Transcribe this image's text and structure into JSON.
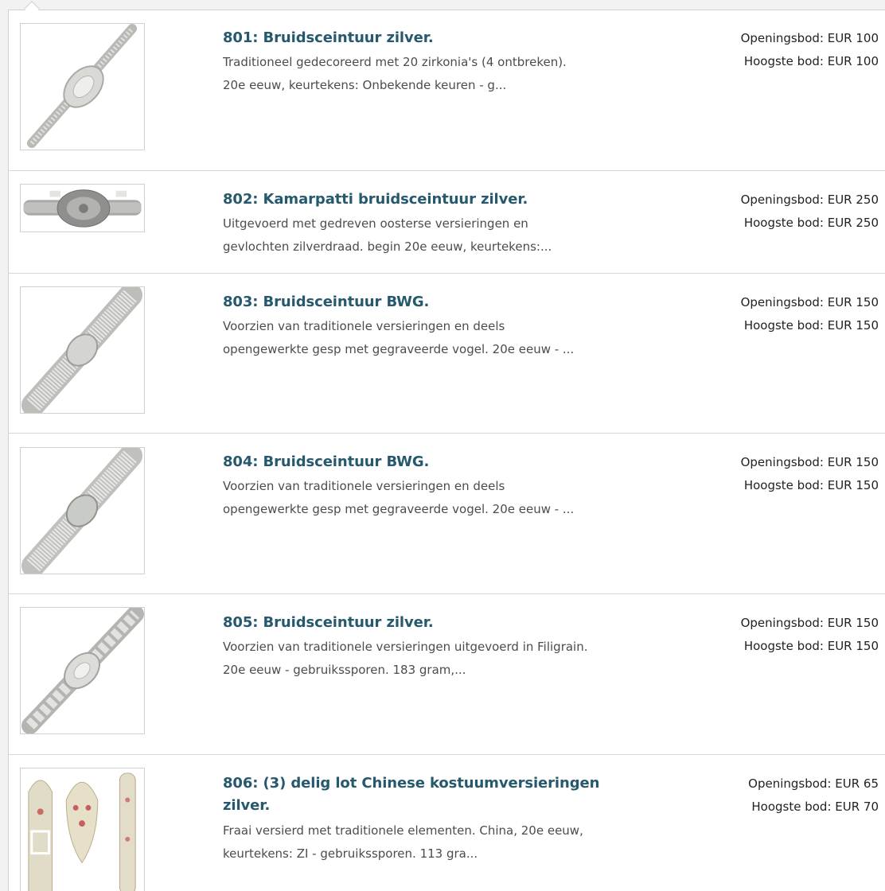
{
  "lots": [
    {
      "title": "801: Bruidsceintuur zilver.",
      "desc_lines": [
        "Traditioneel gedecoreerd met 20 zirkonia's (4 ontbreken).",
        "20e eeuw, keurtekens: Onbekende keuren - g..."
      ],
      "opening_bid": "Openingsbod: EUR 100",
      "highest_bid": "Hoogste bod: EUR 100",
      "image": "diagonal-belt-thumbnail"
    },
    {
      "title": "802: Kamarpatti bruidsceintuur zilver.",
      "desc_lines": [
        "Uitgevoerd met gedreven oosterse versieringen en",
        "gevlochten zilverdraad. begin 20e eeuw, keurtekens:..."
      ],
      "opening_bid": "Openingsbod: EUR 250",
      "highest_bid": "Hoogste bod: EUR 250",
      "image": "horizontal-belt-thumbnail"
    },
    {
      "title": "803: Bruidsceintuur BWG.",
      "desc_lines": [
        "Voorzien van traditionele versieringen en deels",
        "opengewerkte gesp met gegraveerde vogel. 20e eeuw - ..."
      ],
      "opening_bid": "Openingsbod: EUR 150",
      "highest_bid": "Hoogste bod: EUR 150",
      "image": "diagonal-mesh-belt-thumbnail"
    },
    {
      "title": "804: Bruidsceintuur BWG.",
      "desc_lines": [
        "Voorzien van traditionele versieringen en deels",
        "opengewerkte gesp met gegraveerde vogel. 20e eeuw - ..."
      ],
      "opening_bid": "Openingsbod: EUR 150",
      "highest_bid": "Hoogste bod: EUR 150",
      "image": "diagonal-mesh-belt-thumbnail"
    },
    {
      "title": "805: Bruidsceintuur zilver.",
      "desc_lines": [
        "Voorzien van traditionele versieringen uitgevoerd in Filigrain.",
        "20e eeuw - gebruikssporen. 183 gram,..."
      ],
      "opening_bid": "Openingsbod: EUR 150",
      "highest_bid": "Hoogste bod: EUR 150",
      "image": "diagonal-filigree-belt-thumbnail"
    },
    {
      "title_lines": [
        "806: (3) delig lot Chinese kostuumversieringen",
        "zilver."
      ],
      "desc_lines": [
        "Fraai versierd met traditionele elementen. China, 20e eeuw,",
        "keurtekens: ZI - gebruikssporen. 113 gra..."
      ],
      "opening_bid": "Openingsbod: EUR 65",
      "highest_bid": "Hoogste bod: EUR 70",
      "image": "chinese-ornaments-thumbnail"
    }
  ]
}
